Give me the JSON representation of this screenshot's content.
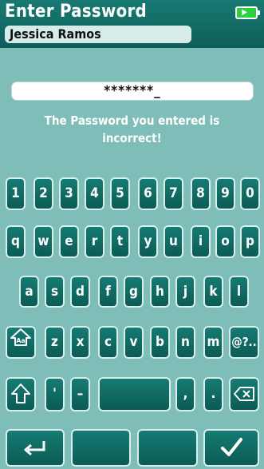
{
  "header": {
    "title": "Enter Password",
    "username": "Jessica Ramos",
    "battery_icon": "battery-charging-icon"
  },
  "password": {
    "masked_value": "*******_"
  },
  "error": {
    "line1": "The Password you entered is",
    "line2": "incorrect!"
  },
  "keyboard": {
    "row1": [
      "1",
      "2",
      "3",
      "4",
      "5",
      "6",
      "7",
      "8",
      "9",
      "0"
    ],
    "row2": [
      "q",
      "w",
      "e",
      "r",
      "t",
      "y",
      "u",
      "i",
      "o",
      "p"
    ],
    "row3": [
      "a",
      "s",
      "d",
      "f",
      "g",
      "h",
      "j",
      "k",
      "l"
    ],
    "row4": [
      "z",
      "x",
      "c",
      "v",
      "b",
      "n",
      "m"
    ],
    "symbols_key": "@?..",
    "row5_chars": [
      "'",
      "–",
      ",",
      "."
    ],
    "icons": {
      "case_toggle": "case-toggle-icon",
      "shift": "shift-arrow-icon",
      "backspace": "backspace-icon",
      "enter": "enter-arrow-icon",
      "confirm": "checkmark-icon"
    }
  }
}
